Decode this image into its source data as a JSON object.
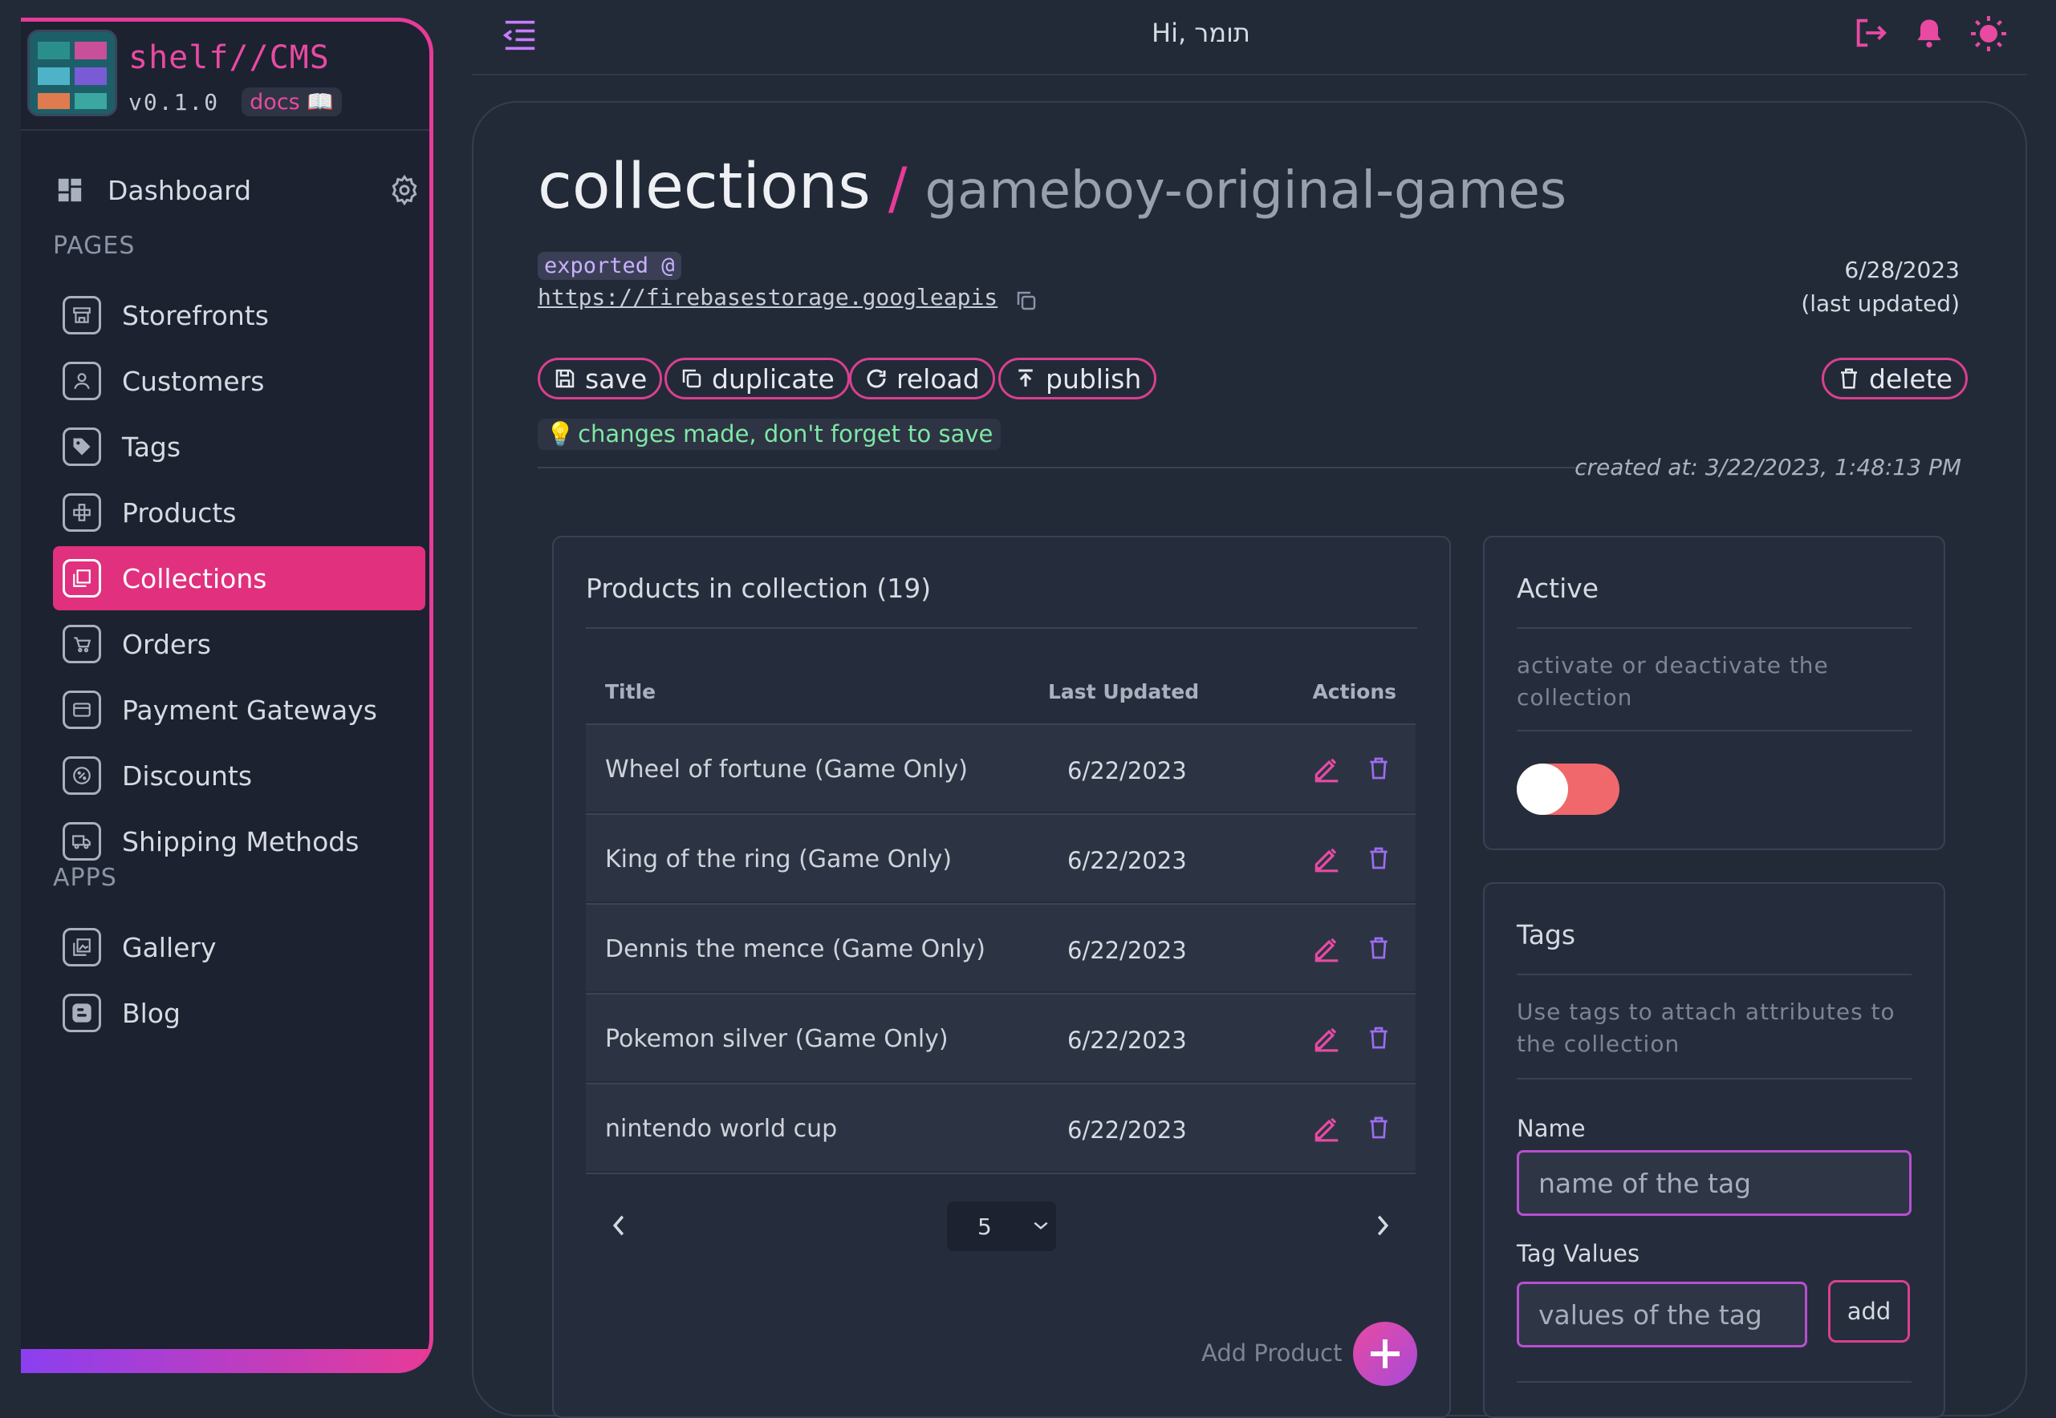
{
  "brand": {
    "name": "shelf//CMS",
    "version": "v0.1.0",
    "docs_label": "docs 📖"
  },
  "sidebar": {
    "dashboard": "Dashboard",
    "pages_head": "PAGES",
    "apps_head": "APPS",
    "pages": [
      {
        "label": "Storefronts",
        "icon": "storefront-icon"
      },
      {
        "label": "Customers",
        "icon": "user-icon"
      },
      {
        "label": "Tags",
        "icon": "tag-icon"
      },
      {
        "label": "Products",
        "icon": "gamepad-icon"
      },
      {
        "label": "Collections",
        "icon": "collections-icon",
        "active": true
      },
      {
        "label": "Orders",
        "icon": "cart-icon"
      },
      {
        "label": "Payment Gateways",
        "icon": "credit-card-icon"
      },
      {
        "label": "Discounts",
        "icon": "discount-icon"
      },
      {
        "label": "Shipping Methods",
        "icon": "truck-icon"
      }
    ],
    "apps": [
      {
        "label": "Gallery",
        "icon": "image-icon"
      },
      {
        "label": "Blog",
        "icon": "blogger-icon"
      }
    ]
  },
  "topbar": {
    "greeting": "Hi, תומר"
  },
  "page": {
    "title": "collections",
    "separator": "/",
    "subtitle": "gameboy-original-games",
    "exported_label": "exported @",
    "export_url": "https://firebasestorage.googleapis",
    "last_updated_date": "6/28/2023",
    "last_updated_label": "(last updated)",
    "buttons": {
      "save": "save",
      "duplicate": "duplicate",
      "reload": "reload",
      "publish": "publish",
      "delete": "delete"
    },
    "hint": "changes made, don't forget to save",
    "created_at": "created at: 3/22/2023, 1:48:13 PM"
  },
  "products_panel": {
    "title": "Products in collection (19)",
    "columns": {
      "title": "Title",
      "last_updated": "Last Updated",
      "actions": "Actions"
    },
    "rows": [
      {
        "title": "Wheel of fortune (Game Only)",
        "date": "6/22/2023"
      },
      {
        "title": "King of the ring (Game Only)",
        "date": "6/22/2023"
      },
      {
        "title": "Dennis the mence (Game Only)",
        "date": "6/22/2023"
      },
      {
        "title": "Pokemon silver (Game Only)",
        "date": "6/22/2023"
      },
      {
        "title": "nintendo world cup",
        "date": "6/22/2023"
      }
    ],
    "page_size": "5",
    "add_product_label": "Add Product"
  },
  "active_panel": {
    "title": "Active",
    "description": "activate or deactivate the collection",
    "active": false
  },
  "tags_panel": {
    "title": "Tags",
    "description": "Use tags to attach attributes to the collection",
    "name_label": "Name",
    "name_placeholder": "name of the tag",
    "values_label": "Tag Values",
    "values_placeholder": "values of the tag",
    "add_label": "add"
  },
  "colors": {
    "accent": "#e73b98",
    "background": "#222a38",
    "sidebar": "#1c2230",
    "hint_text": "#7ee8a5",
    "toggle_off": "#f0686c"
  }
}
